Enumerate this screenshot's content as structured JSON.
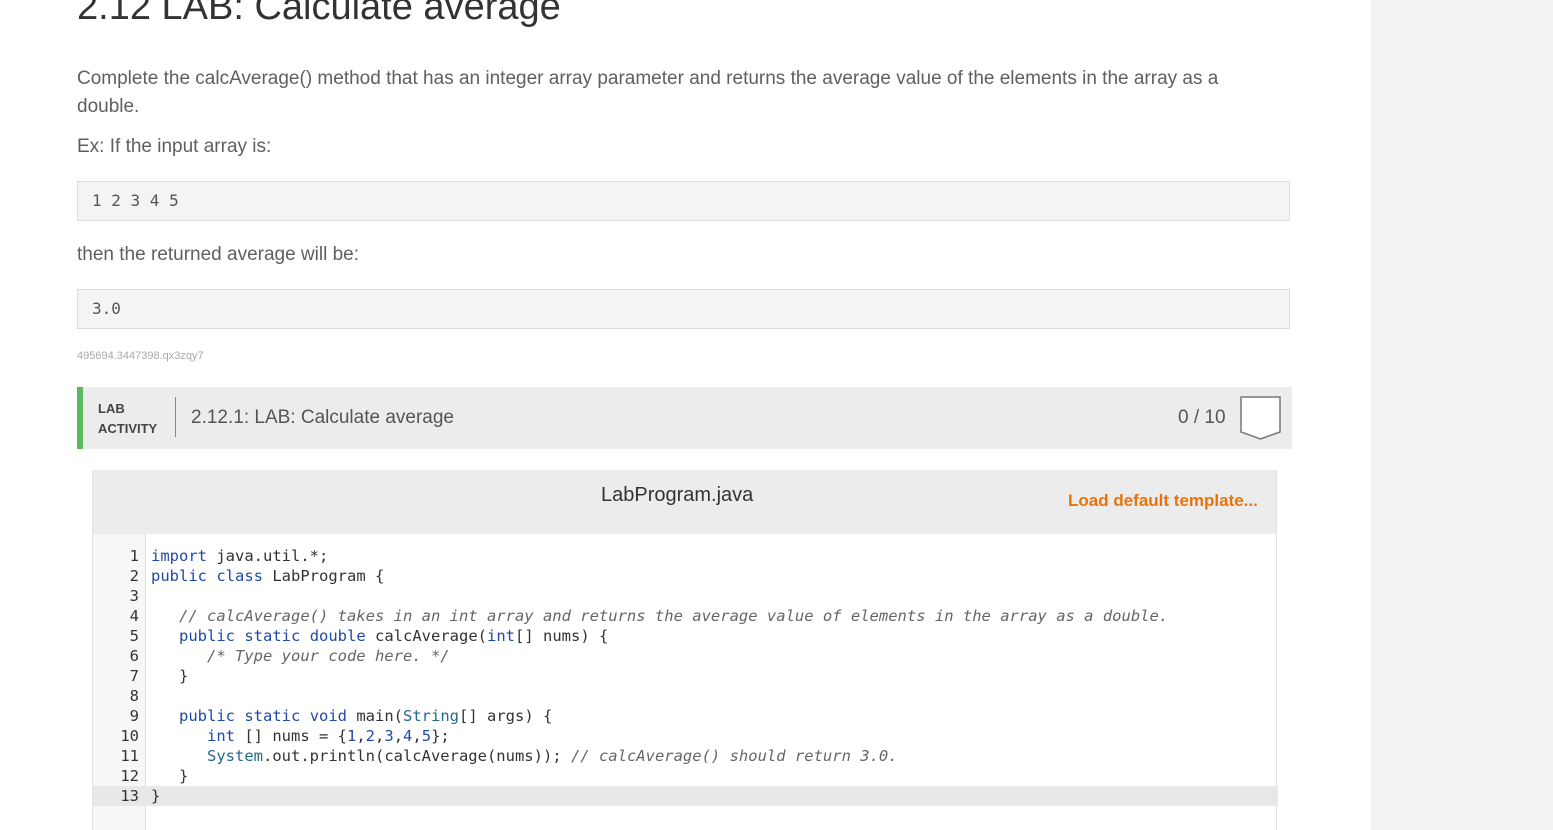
{
  "page": {
    "title": "2.12 LAB: Calculate average",
    "description": "Complete the calcAverage() method that has an integer array parameter and returns the average value of the elements in the array as a double.",
    "example_intro": "Ex: If the input array is:",
    "example_input": "1 2 3 4 5",
    "result_intro": "then the returned average will be:",
    "example_output": "3.0",
    "hash_id": "495694.3447398.qx3zqy7"
  },
  "lab": {
    "tag_line1": "LAB",
    "tag_line2": "ACTIVITY",
    "name": "2.12.1: LAB: Calculate average",
    "score": "0 / 10",
    "accent_color": "#5cb85c"
  },
  "editor": {
    "file_name": "LabProgram.java",
    "load_template_label": "Load default template...",
    "load_template_color": "#e8730b",
    "lines": [
      {
        "n": "1",
        "text": "import java.util.*;"
      },
      {
        "n": "2",
        "text": "public class LabProgram {"
      },
      {
        "n": "3",
        "text": ""
      },
      {
        "n": "4",
        "text": "   // calcAverage() takes in an int array and returns the average value of elements in the array as a double."
      },
      {
        "n": "5",
        "text": "   public static double calcAverage(int[] nums) {"
      },
      {
        "n": "6",
        "text": "      /* Type your code here. */"
      },
      {
        "n": "7",
        "text": "   }"
      },
      {
        "n": "8",
        "text": ""
      },
      {
        "n": "9",
        "text": "   public static void main(String[] args) {"
      },
      {
        "n": "10",
        "text": "      int [] nums = {1,2,3,4,5};"
      },
      {
        "n": "11",
        "text": "      System.out.println(calcAverage(nums)); // calcAverage() should return 3.0."
      },
      {
        "n": "12",
        "text": "   }"
      },
      {
        "n": "13",
        "text": "}"
      }
    ],
    "active_line": "13"
  }
}
